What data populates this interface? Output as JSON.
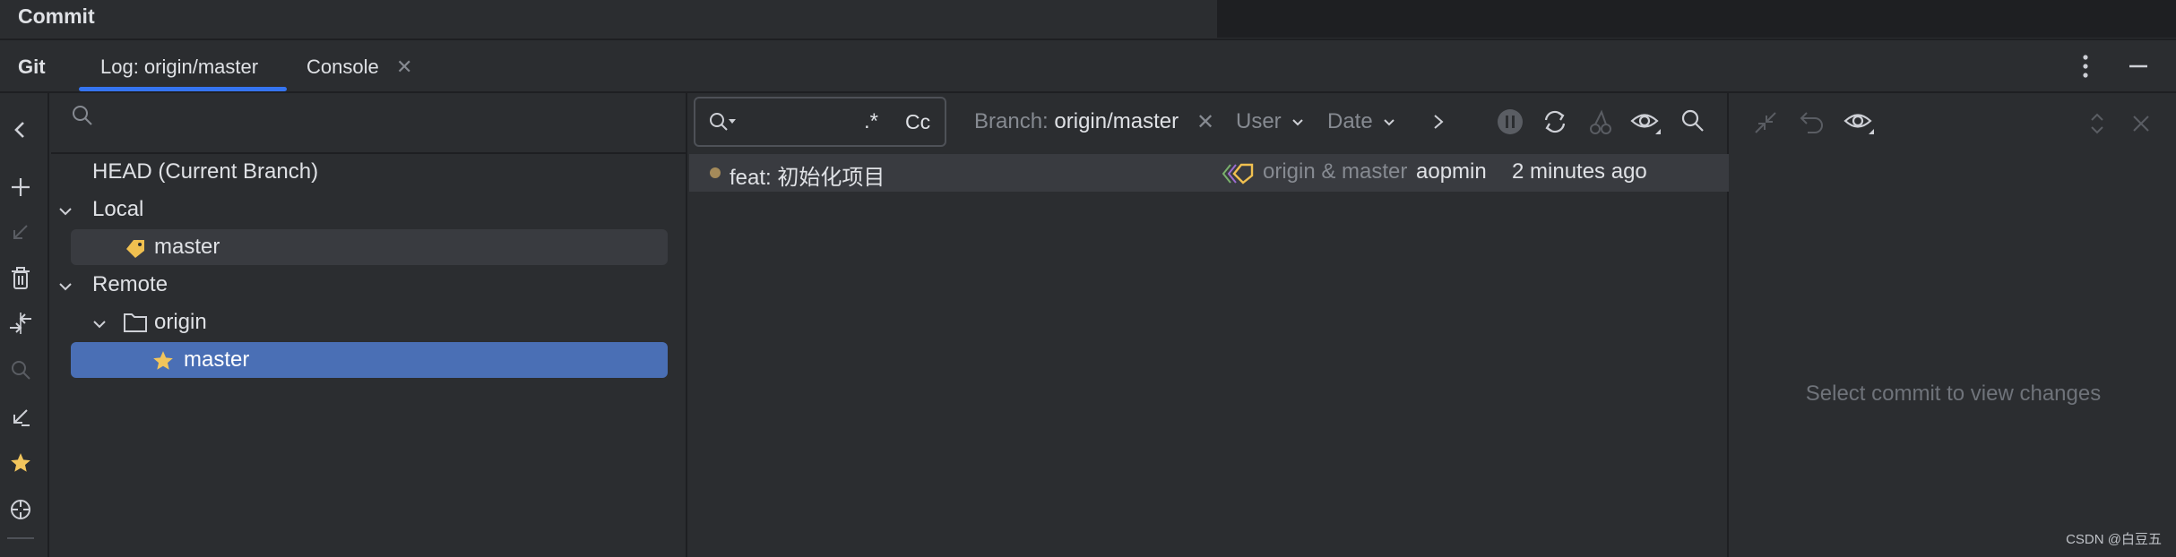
{
  "commit_bar": {
    "title": "Commit"
  },
  "toolwindow": {
    "title": "Git",
    "tabs": [
      {
        "label": "Log: origin/master",
        "active": true
      },
      {
        "label": "Console",
        "closable": true
      }
    ]
  },
  "branches": {
    "search_placeholder": "",
    "head": "HEAD (Current Branch)",
    "local_label": "Local",
    "local_branches": [
      "master"
    ],
    "remote_label": "Remote",
    "remote_group": "origin",
    "remote_branches": [
      "master"
    ]
  },
  "log": {
    "search_regex": ".*",
    "search_case": "Cc",
    "branch_filter_label": "Branch:",
    "branch_filter_value": "origin/master",
    "user_filter": "User",
    "date_filter": "Date",
    "commits": [
      {
        "message": "feat: 初始化项目",
        "refs": "origin & master",
        "author": "aopmin",
        "date": "2 minutes ago"
      }
    ]
  },
  "details": {
    "empty_message": "Select commit to view changes"
  },
  "watermark": "CSDN @白豆五",
  "colors": {
    "accent": "#3574f0",
    "selection": "#4a6fb5",
    "tag_yellow": "#f0c050",
    "background": "#2b2d30"
  }
}
